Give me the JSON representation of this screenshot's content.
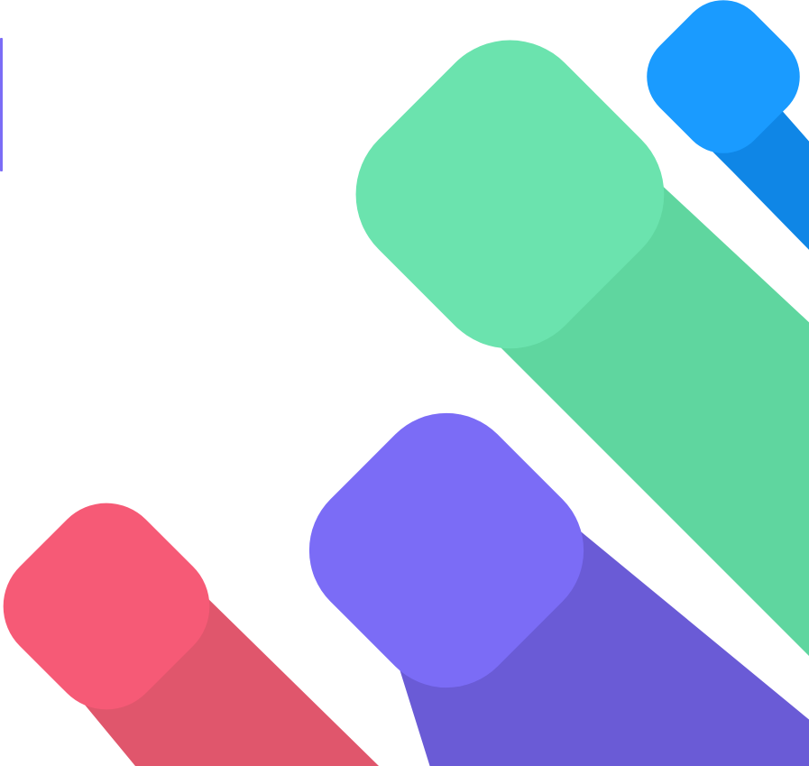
{
  "artwork": {
    "style": "flat long-shadow rounded squares",
    "background_color": "#ffffff",
    "left_edge_strip_color": "#7b6cf6",
    "shapes": [
      {
        "id": "blue",
        "face_color": "#1a9bff",
        "shadow_color": "#0f86e6"
      },
      {
        "id": "green",
        "face_color": "#6be3ae",
        "shadow_color": "#5fd69f"
      },
      {
        "id": "purple",
        "face_color": "#7b6cf6",
        "shadow_color": "#6a5bd6"
      },
      {
        "id": "red",
        "face_color": "#f65a76",
        "shadow_color": "#e0566c"
      }
    ]
  }
}
